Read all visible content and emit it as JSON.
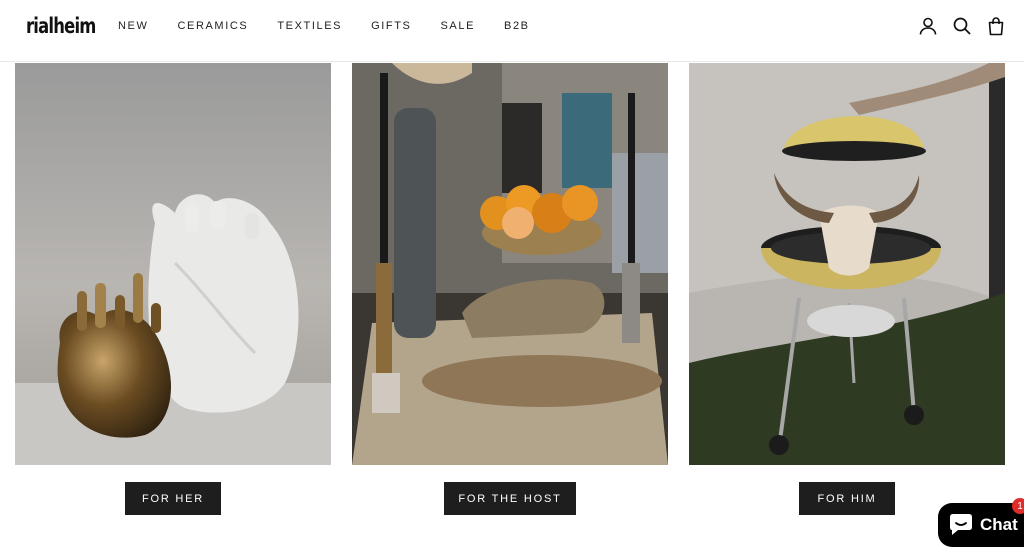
{
  "brand": {
    "logo_text": "rialheim"
  },
  "nav": {
    "items": [
      {
        "label": "NEW"
      },
      {
        "label": "CERAMICS"
      },
      {
        "label": "TEXTILES"
      },
      {
        "label": "GIFTS"
      },
      {
        "label": "SALE"
      },
      {
        "label": "B2B"
      }
    ]
  },
  "header_icons": [
    "account-icon",
    "search-icon",
    "cart-bag-icon"
  ],
  "collections": [
    {
      "button_label": "FOR HER",
      "image_subject": "heart-vases-icon"
    },
    {
      "button_label": "FOR THE HOST",
      "image_subject": "table-setting-icon"
    },
    {
      "button_label": "FOR HIM",
      "image_subject": "grill-icon"
    }
  ],
  "chat": {
    "label": "Chat",
    "badge_count": "1"
  },
  "colors": {
    "button_bg": "#1e1e1e",
    "chat_bg": "#000000",
    "badge": "#e02b2b"
  }
}
